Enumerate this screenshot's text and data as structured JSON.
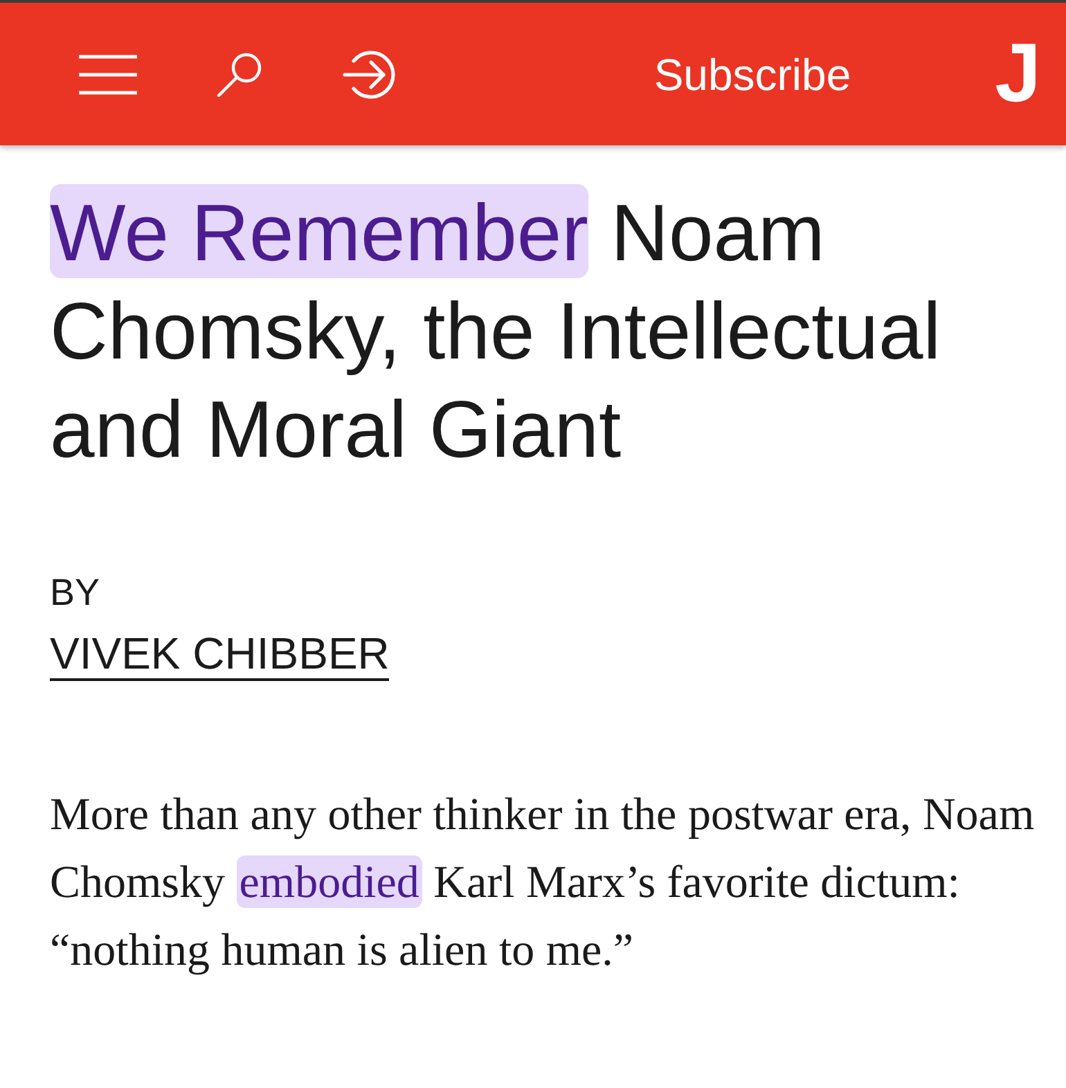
{
  "header": {
    "subscribe_label": "Subscribe",
    "logo": "J"
  },
  "headline": {
    "segments": [
      {
        "text": "We Remember",
        "highlighted": true
      },
      {
        "text": "Noam Chomsky, the Intellectual and Moral Giant",
        "highlighted": false
      }
    ]
  },
  "byline": {
    "label": "BY",
    "author": "VIVEK CHIBBER"
  },
  "paragraph": {
    "segments": [
      {
        "text": "More than any other thinker in the postwar era, Noam Chomsky",
        "highlighted": false
      },
      {
        "text": "embodied",
        "highlighted": true
      },
      {
        "text": "Karl Marx’s favorite dictum: “nothing human is alien to me.”",
        "highlighted": false
      }
    ]
  }
}
